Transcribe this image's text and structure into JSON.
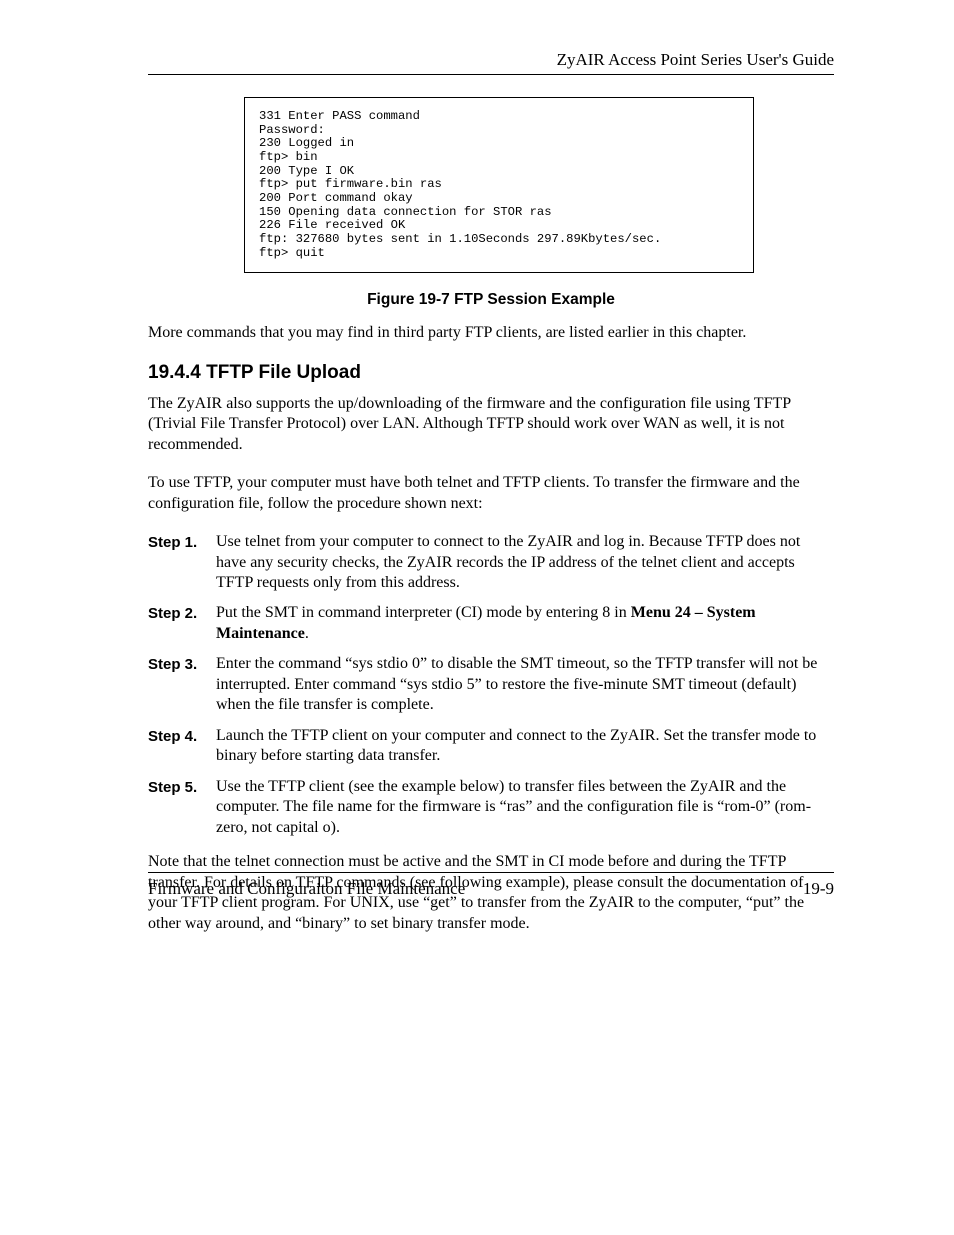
{
  "header": {
    "guide_title": "ZyAIR Access Point Series User's Guide"
  },
  "code_block": "331 Enter PASS command\nPassword:\n230 Logged in\nftp> bin\n200 Type I OK\nftp> put firmware.bin ras\n200 Port command okay\n150 Opening data connection for STOR ras\n226 File received OK\nftp: 327680 bytes sent in 1.10Seconds 297.89Kbytes/sec.\nftp> quit",
  "figure_caption": "Figure 19-7 FTP Session Example",
  "para_intro": "More commands that you may find in third party FTP clients, are listed earlier in this chapter.",
  "section_heading": "19.4.4 TFTP File Upload",
  "para1": "The ZyAIR also supports the up/downloading of the firmware and the configuration file using TFTP (Trivial File Transfer Protocol) over LAN. Although TFTP should work over WAN as well, it is not recommended.",
  "para2": "To use TFTP, your computer must have both telnet and TFTP clients. To transfer the firmware and the configuration file, follow the procedure shown next:",
  "steps": [
    {
      "label": "Step 1.",
      "text": "Use telnet from your computer to connect to the ZyAIR and log in. Because TFTP does not have any security checks, the ZyAIR records the IP address of the telnet client and accepts TFTP requests only from this address."
    },
    {
      "label": "Step 2.",
      "text_before": "Put the SMT in command interpreter (CI) mode by entering 8 in ",
      "bold": "Menu 24 – System Maintenance",
      "text_after": "."
    },
    {
      "label": "Step 3.",
      "text": "Enter the command “sys stdio 0” to disable the SMT timeout, so the TFTP transfer will not be interrupted. Enter command “sys stdio 5” to restore the five-minute SMT timeout (default) when the file transfer is complete."
    },
    {
      "label": "Step 4.",
      "text": "Launch the TFTP client on your computer and connect to the ZyAIR. Set the transfer mode to binary before starting data transfer."
    },
    {
      "label": "Step 5.",
      "text": "Use the TFTP client (see the example below) to transfer files between the ZyAIR and the computer. The file name for the firmware is “ras” and the configuration file is “rom-0” (rom-zero, not capital o)."
    }
  ],
  "para_note": "Note that the telnet connection must be active and the SMT in CI mode before and during the TFTP transfer. For details on TFTP commands (see following example), please consult the documentation of your TFTP client program. For UNIX, use “get” to transfer from the ZyAIR to the computer, “put” the other way around, and “binary” to set binary transfer mode.",
  "footer": {
    "left": "Firmware and Configuraiton File Maintenance",
    "right": "19-9"
  }
}
